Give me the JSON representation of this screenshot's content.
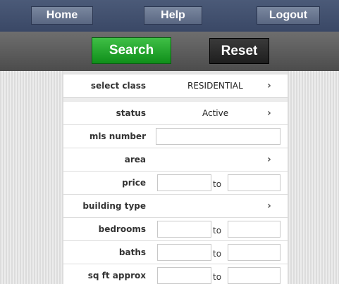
{
  "nav": {
    "home": "Home",
    "help": "Help",
    "logout": "Logout"
  },
  "actions": {
    "search": "Search",
    "reset": "Reset"
  },
  "form": {
    "select_class": {
      "label": "select class",
      "value": "RESIDENTIAL"
    },
    "status": {
      "label": "status",
      "value": "Active"
    },
    "mls_number": {
      "label": "mls number",
      "value": ""
    },
    "area": {
      "label": "area"
    },
    "price": {
      "label": "price",
      "to": "to"
    },
    "building_type": {
      "label": "building type"
    },
    "bedrooms": {
      "label": "bedrooms",
      "to": "to"
    },
    "baths": {
      "label": "baths",
      "to": "to"
    },
    "sq_ft": {
      "label": "sq ft approx",
      "to": "to"
    }
  },
  "chevron_icon": "chevron-right"
}
